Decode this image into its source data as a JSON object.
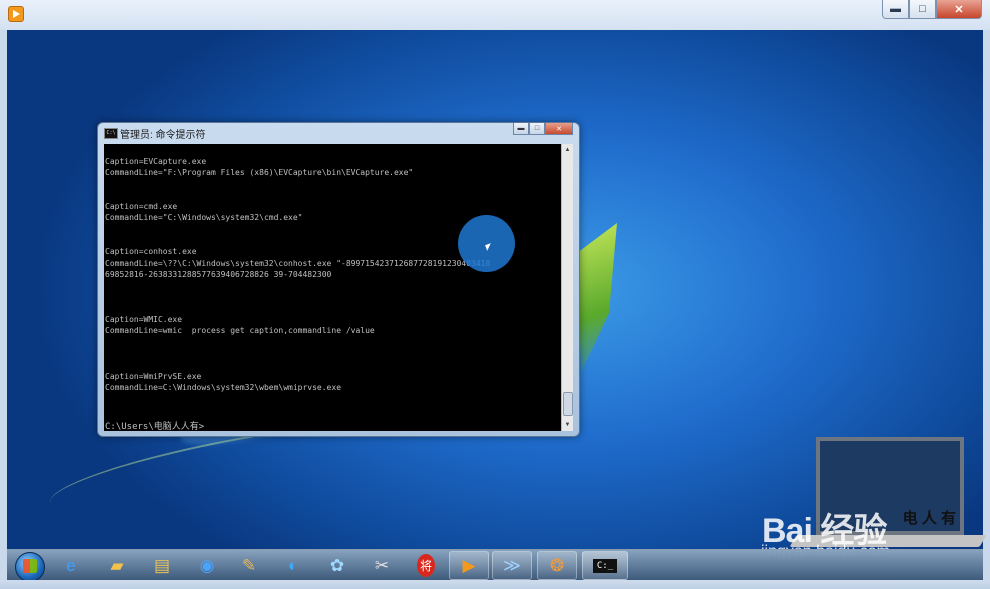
{
  "cmd": {
    "title": "管理员: 命令提示符",
    "icon_label": "C:\\",
    "lines": "Caption=EVCapture.exe\nCommandLine=\"F:\\Program Files (x86)\\EVCapture\\bin\\EVCapture.exe\"\n\n\nCaption=cmd.exe\nCommandLine=\"C:\\Windows\\system32\\cmd.exe\"\n\n\nCaption=conhost.exe\nCommandLine=\\??\\C:\\Windows\\system32\\conhost.exe \"-899715423712687728191230403418\n69852816-2638331288577639406728826 39-704482300\n\n\n\nCaption=WMIC.exe\nCommandLine=wmic  process get caption,commandline /value\n\n\n\nCaption=WmiPrvSE.exe\nCommandLine=C:\\Windows\\system32\\wbem\\wmiprvse.exe",
    "prompt": "C:\\Users\\电脑人人有>"
  },
  "watermark": {
    "brand": "Bai 经验",
    "url": "jingyan.baidu.com",
    "laptop_text": "电 人 有"
  },
  "taskbar": {
    "items": [
      {
        "name": "ie-icon",
        "glyph": "e",
        "color": "#3aa0ff"
      },
      {
        "name": "folder-icon",
        "glyph": "▰",
        "color": "#f2c24b"
      },
      {
        "name": "file-manager-icon",
        "glyph": "▤",
        "color": "#e8c15a"
      },
      {
        "name": "media-icon",
        "glyph": "◉",
        "color": "#4aa3ff"
      },
      {
        "name": "paint-icon",
        "glyph": "✎",
        "color": "#e6b45a"
      },
      {
        "name": "browser-icon",
        "glyph": "◐",
        "color": "#3fa7f5"
      },
      {
        "name": "pinwheel-icon",
        "glyph": "✿",
        "color": "#9ed8ff"
      },
      {
        "name": "tools-icon",
        "glyph": "✂",
        "color": "#e0e0e0"
      },
      {
        "name": "chess-icon",
        "glyph": "将",
        "color": "#ffffff"
      },
      {
        "name": "player-icon",
        "glyph": "▶",
        "color": "#f39a1e"
      },
      {
        "name": "powershell-icon",
        "glyph": "≫",
        "color": "#9fd0ff"
      },
      {
        "name": "firefox-icon",
        "glyph": "❂",
        "color": "#f39a3a"
      },
      {
        "name": "cmd-icon",
        "glyph": "C:_",
        "color": "#ffffff"
      }
    ]
  }
}
